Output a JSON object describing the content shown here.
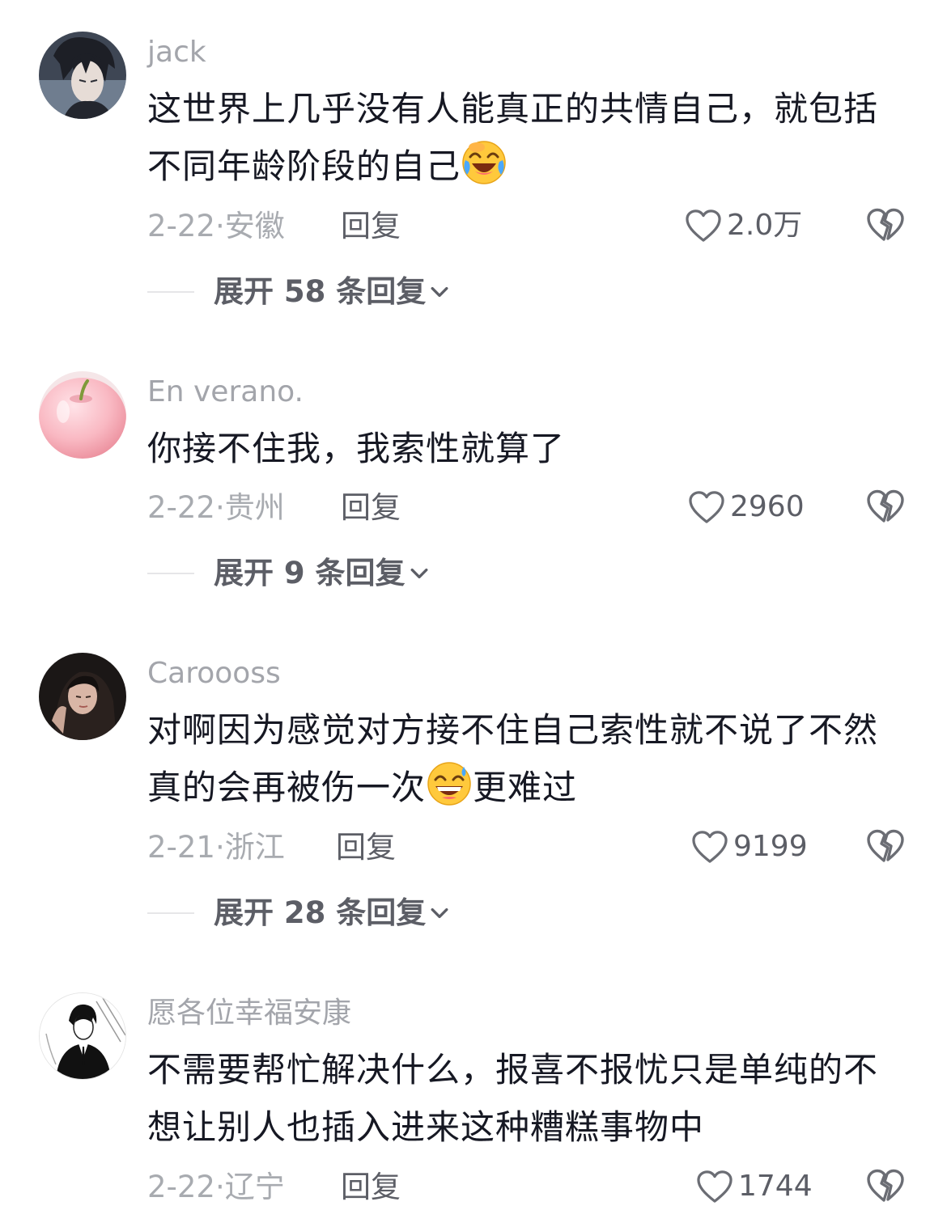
{
  "comments": [
    {
      "username": "jack",
      "text_line1": "这世界上几乎没有人能真正的共情自己，就包括",
      "text_line2": "不同年龄阶段的自己",
      "emoji_icon": "crying-laughing-emoji",
      "date": "2-22",
      "location": "安徽",
      "reply_label": "回复",
      "likes": "2.0万",
      "expand_label": "展开 58 条回复"
    },
    {
      "username": "En verano.",
      "text_line1": "你接不住我，我索性就算了",
      "date": "2-22",
      "location": "贵州",
      "reply_label": "回复",
      "likes": "2960",
      "expand_label": "展开 9 条回复"
    },
    {
      "username": "Caroooss",
      "text_line1": "对啊因为感觉对方接不住自己索性就不说了不然",
      "text_line2_before": "真的会再被伤一次",
      "text_line2_after": "更难过",
      "emoji_icon": "grinning-sweat-emoji",
      "date": "2-21",
      "location": "浙江",
      "reply_label": "回复",
      "likes": "9199",
      "expand_label": "展开 28 条回复"
    },
    {
      "username": "愿各位幸福安康",
      "text_line1": "不需要帮忙解决什么，报喜不报忧只是单纯的不",
      "text_line2": "想让别人也插入进来这种糟糕事物中",
      "date": "2-22",
      "location": "辽宁",
      "reply_label": "回复",
      "likes": "1744"
    }
  ],
  "meta_separator": "·",
  "icons": {
    "like": "heart-outline-icon",
    "dislike": "broken-heart-icon",
    "expand": "chevron-down-icon"
  },
  "colors": {
    "text": "#161823",
    "muted": "#a8abb0",
    "action": "#5c5e66",
    "background": "#ffffff"
  }
}
